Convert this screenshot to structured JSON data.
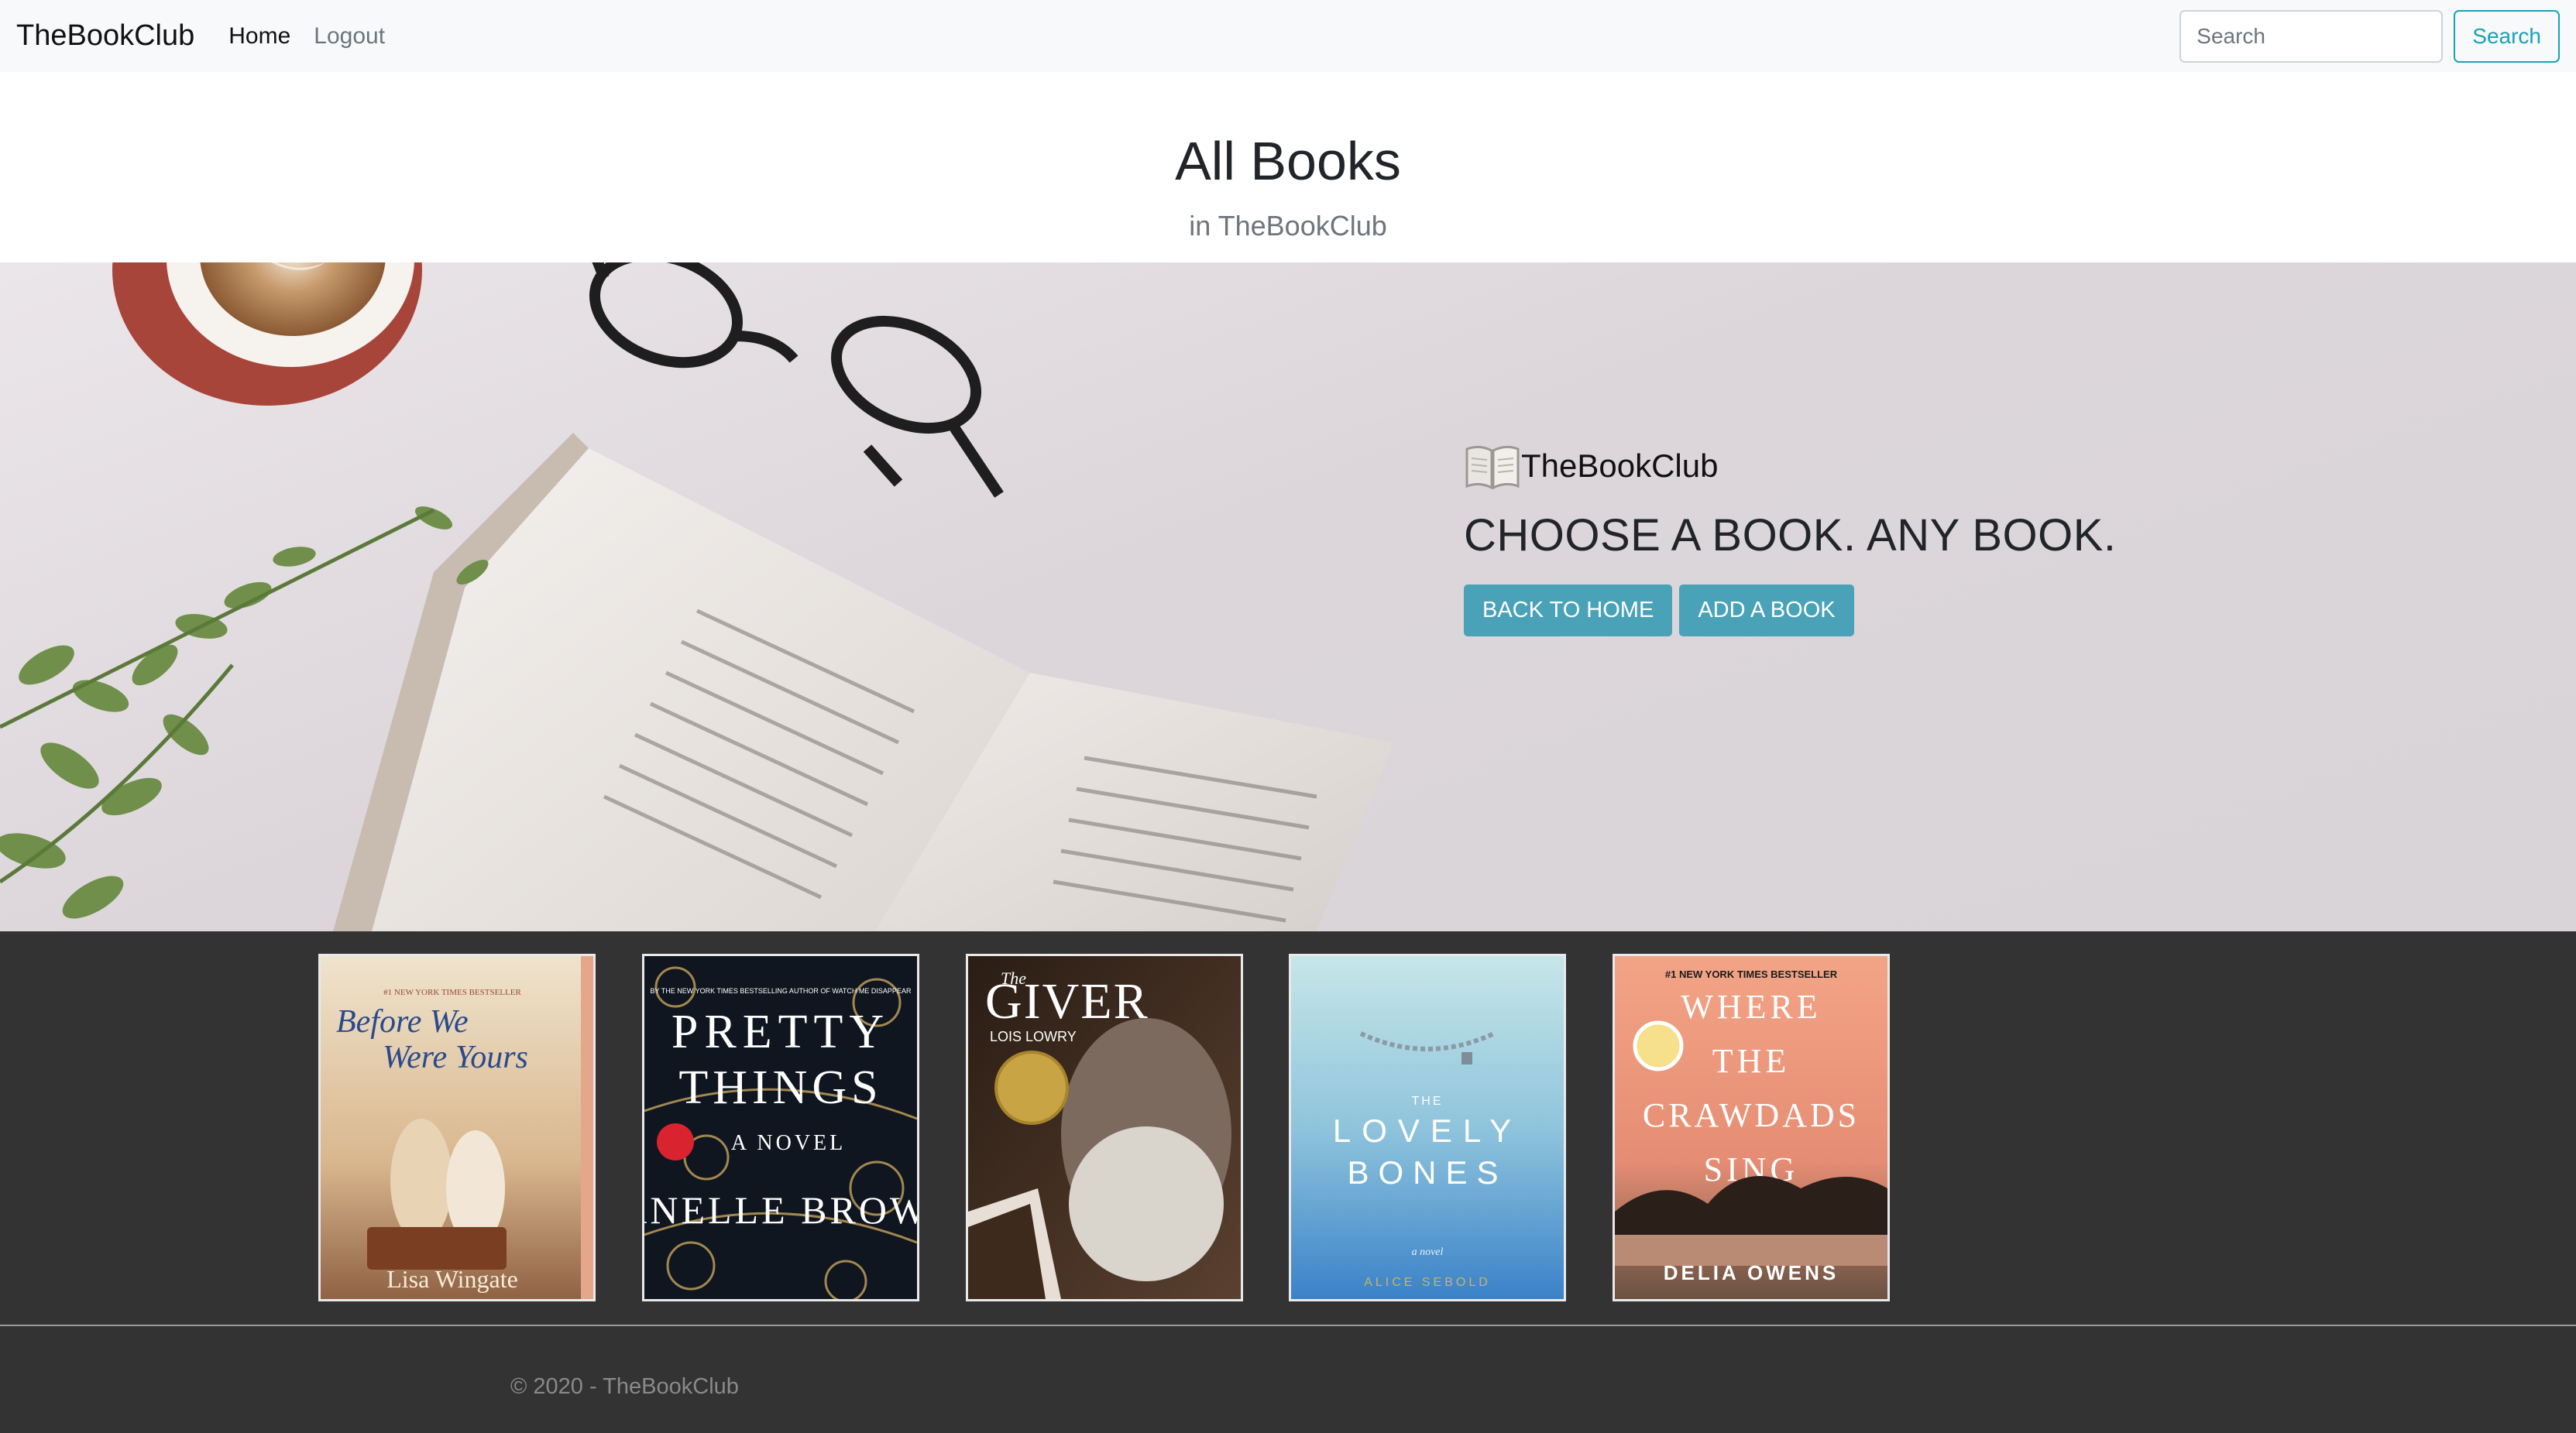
{
  "navbar": {
    "brand": "TheBookClub",
    "links": [
      {
        "label": "Home",
        "active": true
      },
      {
        "label": "Logout",
        "active": false
      }
    ],
    "search": {
      "placeholder": "Search",
      "value": "",
      "button_label": "Search"
    }
  },
  "header": {
    "title": "All Books",
    "subtitle": "in TheBookClub"
  },
  "hero": {
    "brand_icon": "open-book-icon",
    "brand": "TheBookClub",
    "headline": "CHOOSE A BOOK. ANY BOOK.",
    "buttons": [
      "BACK TO HOME",
      "ADD A BOOK"
    ]
  },
  "books": [
    {
      "cover_lines": [
        "Before We",
        "Were Yours"
      ],
      "author": "Lisa Wingate",
      "tagline": "#1 NEW YORK TIMES BESTSELLER",
      "colors": {
        "top": "#e8dcc7",
        "bottom": "#b08560",
        "title": "#2b4a8c"
      }
    },
    {
      "cover_lines": [
        "PRETTY",
        "THINGS"
      ],
      "subtitle": "A NOVEL",
      "author": "JANELLE BROWN",
      "tagline": "BY THE NEW YORK TIMES BESTSELLING AUTHOR OF WATCH ME DISAPPEAR",
      "colors": {
        "top": "#0f1620",
        "bottom": "#1a2533",
        "title": "#ffffff"
      }
    },
    {
      "cover_lines": [
        "GIVER"
      ],
      "prefix": "The",
      "author": "LOIS LOWRY",
      "colors": {
        "top": "#2a1d14",
        "bottom": "#5a4030",
        "title": "#ffffff"
      }
    },
    {
      "cover_lines": [
        "LOVELY",
        "BONES"
      ],
      "prefix": "THE",
      "subtitle": "a novel",
      "author": "ALICE SEBOLD",
      "colors": {
        "top": "#bfe1e6",
        "bottom": "#3f87c9",
        "title": "#ffffff"
      }
    },
    {
      "cover_lines": [
        "WHERE",
        "THE",
        "CRAWDADS",
        "SING"
      ],
      "author": "DELIA OWENS",
      "tagline": "#1 NEW YORK TIMES BESTSELLER",
      "colors": {
        "top": "#f2a284",
        "bottom": "#5e4a3a",
        "title": "#ffffff"
      }
    }
  ],
  "footer": {
    "text": "© 2020 - TheBookClub"
  }
}
